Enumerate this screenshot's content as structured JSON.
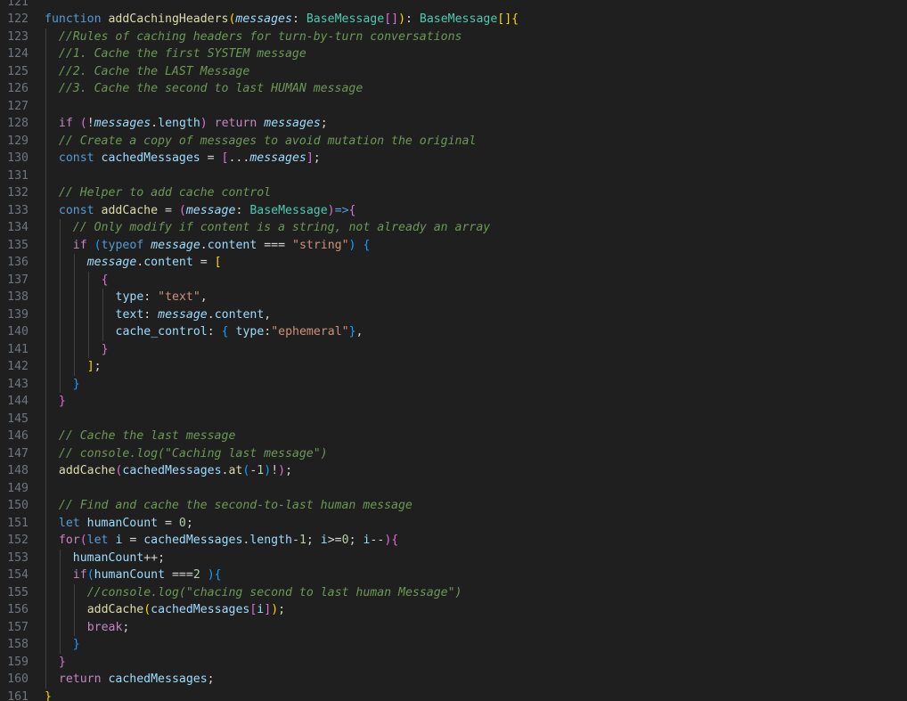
{
  "editor": {
    "colors": {
      "background": "#1f1f1f",
      "line_number": "#6e7681",
      "keyword": "#569cd6",
      "control": "#c586c0",
      "function": "#dcdcaa",
      "type": "#4ec9b0",
      "variable": "#9cdcfe",
      "string": "#ce9178",
      "number": "#b5cea8",
      "comment": "#6a9955",
      "bracket_1": "#ffd700",
      "bracket_2": "#da70d6",
      "bracket_3": "#179fff"
    },
    "lines": [
      {
        "n": "121",
        "indent": 0,
        "tokens": []
      },
      {
        "n": "122",
        "indent": 0,
        "tokens": [
          [
            "kw",
            "function"
          ],
          [
            "pun",
            " "
          ],
          [
            "fn",
            "addCachingHeaders"
          ],
          [
            "b1",
            "("
          ],
          [
            "param",
            "messages"
          ],
          [
            "pun",
            ": "
          ],
          [
            "type",
            "BaseMessage"
          ],
          [
            "b2",
            "[]"
          ],
          [
            "b1",
            ")"
          ],
          [
            "pun",
            ": "
          ],
          [
            "type",
            "BaseMessage"
          ],
          [
            "b1",
            "[]{"
          ]
        ]
      },
      {
        "n": "123",
        "indent": 1,
        "tokens": [
          [
            "cm",
            "//Rules of caching headers for turn-by-turn conversations"
          ]
        ]
      },
      {
        "n": "124",
        "indent": 1,
        "tokens": [
          [
            "cm",
            "//1. Cache the first SYSTEM message"
          ]
        ]
      },
      {
        "n": "125",
        "indent": 1,
        "tokens": [
          [
            "cm",
            "//2. Cache the LAST Message"
          ]
        ]
      },
      {
        "n": "126",
        "indent": 1,
        "tokens": [
          [
            "cm",
            "//3. Cache the second to last HUMAN message"
          ]
        ]
      },
      {
        "n": "127",
        "indent": 1,
        "tokens": []
      },
      {
        "n": "128",
        "indent": 1,
        "tokens": [
          [
            "ctl",
            "if"
          ],
          [
            "pun",
            " "
          ],
          [
            "b2",
            "("
          ],
          [
            "op",
            "!"
          ],
          [
            "param",
            "messages"
          ],
          [
            "pun",
            "."
          ],
          [
            "var",
            "length"
          ],
          [
            "b2",
            ")"
          ],
          [
            "pun",
            " "
          ],
          [
            "ctl",
            "return"
          ],
          [
            "pun",
            " "
          ],
          [
            "param",
            "messages"
          ],
          [
            "pun",
            ";"
          ]
        ]
      },
      {
        "n": "129",
        "indent": 1,
        "tokens": [
          [
            "cm",
            "// Create a copy of messages to avoid mutation the original"
          ]
        ]
      },
      {
        "n": "130",
        "indent": 1,
        "tokens": [
          [
            "kw",
            "const"
          ],
          [
            "pun",
            " "
          ],
          [
            "var",
            "cachedMessages"
          ],
          [
            "op",
            " = "
          ],
          [
            "b2",
            "["
          ],
          [
            "op",
            "..."
          ],
          [
            "param",
            "messages"
          ],
          [
            "b2",
            "]"
          ],
          [
            "pun",
            ";"
          ]
        ]
      },
      {
        "n": "131",
        "indent": 1,
        "tokens": []
      },
      {
        "n": "132",
        "indent": 1,
        "tokens": [
          [
            "cm",
            "// Helper to add cache control"
          ]
        ]
      },
      {
        "n": "133",
        "indent": 1,
        "tokens": [
          [
            "kw",
            "const"
          ],
          [
            "pun",
            " "
          ],
          [
            "fn",
            "addCache"
          ],
          [
            "op",
            " = "
          ],
          [
            "b2",
            "("
          ],
          [
            "param",
            "message"
          ],
          [
            "pun",
            ": "
          ],
          [
            "type",
            "BaseMessage"
          ],
          [
            "b2",
            ")"
          ],
          [
            "kw",
            "=>"
          ],
          [
            "b2",
            "{"
          ]
        ]
      },
      {
        "n": "134",
        "indent": 2,
        "tokens": [
          [
            "cm",
            "// Only modify if content is a string, not already an array"
          ]
        ]
      },
      {
        "n": "135",
        "indent": 2,
        "tokens": [
          [
            "ctl",
            "if"
          ],
          [
            "pun",
            " "
          ],
          [
            "b3",
            "("
          ],
          [
            "kw",
            "typeof"
          ],
          [
            "pun",
            " "
          ],
          [
            "param",
            "message"
          ],
          [
            "pun",
            "."
          ],
          [
            "var",
            "content"
          ],
          [
            "op",
            " === "
          ],
          [
            "str",
            "\"string\""
          ],
          [
            "b3",
            ")"
          ],
          [
            "pun",
            " "
          ],
          [
            "b3",
            "{"
          ]
        ]
      },
      {
        "n": "136",
        "indent": 3,
        "tokens": [
          [
            "param",
            "message"
          ],
          [
            "pun",
            "."
          ],
          [
            "var",
            "content"
          ],
          [
            "op",
            " = "
          ],
          [
            "b1",
            "["
          ]
        ]
      },
      {
        "n": "137",
        "indent": 4,
        "tokens": [
          [
            "b2",
            "{"
          ]
        ]
      },
      {
        "n": "138",
        "indent": 5,
        "tokens": [
          [
            "var",
            "type"
          ],
          [
            "pun",
            ": "
          ],
          [
            "str",
            "\"text\""
          ],
          [
            "pun",
            ","
          ]
        ]
      },
      {
        "n": "139",
        "indent": 5,
        "tokens": [
          [
            "var",
            "text"
          ],
          [
            "pun",
            ": "
          ],
          [
            "param",
            "message"
          ],
          [
            "pun",
            "."
          ],
          [
            "var",
            "content"
          ],
          [
            "pun",
            ","
          ]
        ]
      },
      {
        "n": "140",
        "indent": 5,
        "tokens": [
          [
            "var",
            "cache_control"
          ],
          [
            "pun",
            ": "
          ],
          [
            "b3",
            "{"
          ],
          [
            "pun",
            " "
          ],
          [
            "var",
            "type"
          ],
          [
            "pun",
            ":"
          ],
          [
            "str",
            "\"ephemeral\""
          ],
          [
            "b3",
            "}"
          ],
          [
            "pun",
            ","
          ]
        ]
      },
      {
        "n": "141",
        "indent": 4,
        "tokens": [
          [
            "b2",
            "}"
          ]
        ]
      },
      {
        "n": "142",
        "indent": 3,
        "tokens": [
          [
            "b1",
            "]"
          ],
          [
            "pun",
            ";"
          ]
        ]
      },
      {
        "n": "143",
        "indent": 2,
        "tokens": [
          [
            "b3",
            "}"
          ]
        ]
      },
      {
        "n": "144",
        "indent": 1,
        "tokens": [
          [
            "b2",
            "}"
          ]
        ]
      },
      {
        "n": "145",
        "indent": 1,
        "tokens": []
      },
      {
        "n": "146",
        "indent": 1,
        "tokens": [
          [
            "cm",
            "// Cache the last message"
          ]
        ]
      },
      {
        "n": "147",
        "indent": 1,
        "tokens": [
          [
            "cm",
            "// console.log(\"Caching last message\")"
          ]
        ]
      },
      {
        "n": "148",
        "indent": 1,
        "tokens": [
          [
            "fn",
            "addCache"
          ],
          [
            "b2",
            "("
          ],
          [
            "var",
            "cachedMessages"
          ],
          [
            "pun",
            "."
          ],
          [
            "fn",
            "at"
          ],
          [
            "b3",
            "("
          ],
          [
            "op",
            "-"
          ],
          [
            "num",
            "1"
          ],
          [
            "b3",
            ")"
          ],
          [
            "op",
            "!"
          ],
          [
            "b2",
            ")"
          ],
          [
            "pun",
            ";"
          ]
        ]
      },
      {
        "n": "149",
        "indent": 1,
        "tokens": []
      },
      {
        "n": "150",
        "indent": 1,
        "tokens": [
          [
            "cm",
            "// Find and cache the second-to-last human message"
          ]
        ]
      },
      {
        "n": "151",
        "indent": 1,
        "tokens": [
          [
            "kw",
            "let"
          ],
          [
            "pun",
            " "
          ],
          [
            "var",
            "humanCount"
          ],
          [
            "op",
            " = "
          ],
          [
            "num",
            "0"
          ],
          [
            "pun",
            ";"
          ]
        ]
      },
      {
        "n": "152",
        "indent": 1,
        "tokens": [
          [
            "ctl",
            "for"
          ],
          [
            "b2",
            "("
          ],
          [
            "kw",
            "let"
          ],
          [
            "pun",
            " "
          ],
          [
            "var",
            "i"
          ],
          [
            "op",
            " = "
          ],
          [
            "var",
            "cachedMessages"
          ],
          [
            "pun",
            "."
          ],
          [
            "var",
            "length"
          ],
          [
            "op",
            "-"
          ],
          [
            "num",
            "1"
          ],
          [
            "pun",
            "; "
          ],
          [
            "var",
            "i"
          ],
          [
            "op",
            ">="
          ],
          [
            "num",
            "0"
          ],
          [
            "pun",
            "; "
          ],
          [
            "var",
            "i"
          ],
          [
            "op",
            "--"
          ],
          [
            "b2",
            ")"
          ],
          [
            "b2",
            "{"
          ]
        ]
      },
      {
        "n": "153",
        "indent": 2,
        "tokens": [
          [
            "var",
            "humanCount"
          ],
          [
            "op",
            "++"
          ],
          [
            "pun",
            ";"
          ]
        ]
      },
      {
        "n": "154",
        "indent": 2,
        "tokens": [
          [
            "ctl",
            "if"
          ],
          [
            "b3",
            "("
          ],
          [
            "var",
            "humanCount"
          ],
          [
            "op",
            " ==="
          ],
          [
            "num",
            "2"
          ],
          [
            "pun",
            " "
          ],
          [
            "b3",
            ")"
          ],
          [
            "b3",
            "{"
          ]
        ]
      },
      {
        "n": "155",
        "indent": 3,
        "tokens": [
          [
            "cm",
            "//console.log(\"chacing second to last human Message\")"
          ]
        ]
      },
      {
        "n": "156",
        "indent": 3,
        "tokens": [
          [
            "fn",
            "addCache"
          ],
          [
            "b1",
            "("
          ],
          [
            "var",
            "cachedMessages"
          ],
          [
            "b2",
            "["
          ],
          [
            "var",
            "i"
          ],
          [
            "b2",
            "]"
          ],
          [
            "b1",
            ")"
          ],
          [
            "pun",
            ";"
          ]
        ]
      },
      {
        "n": "157",
        "indent": 3,
        "tokens": [
          [
            "ctl",
            "break"
          ],
          [
            "pun",
            ";"
          ]
        ]
      },
      {
        "n": "158",
        "indent": 2,
        "tokens": [
          [
            "b3",
            "}"
          ]
        ]
      },
      {
        "n": "159",
        "indent": 1,
        "tokens": [
          [
            "b2",
            "}"
          ]
        ]
      },
      {
        "n": "160",
        "indent": 1,
        "tokens": [
          [
            "ctl",
            "return"
          ],
          [
            "pun",
            " "
          ],
          [
            "var",
            "cachedMessages"
          ],
          [
            "pun",
            ";"
          ]
        ]
      },
      {
        "n": "161",
        "indent": 0,
        "tokens": [
          [
            "b1",
            "}"
          ]
        ]
      }
    ]
  }
}
